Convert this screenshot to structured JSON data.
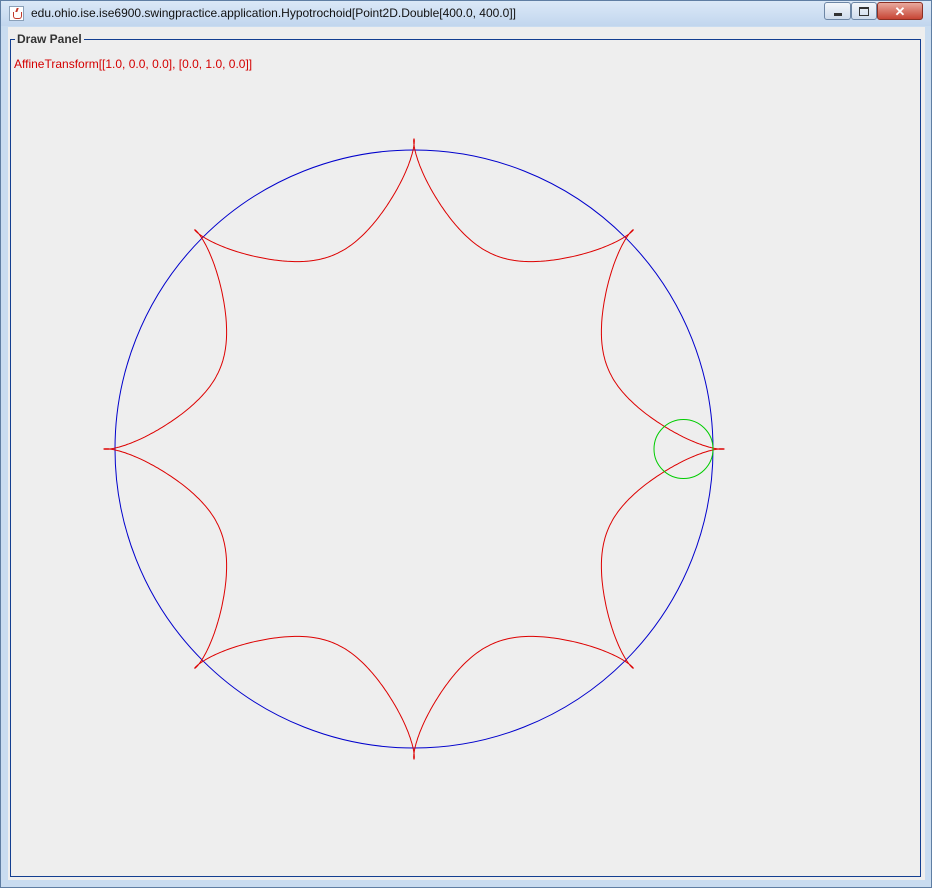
{
  "window": {
    "title": "edu.ohio.ise.ise6900.swingpractice.application.Hypotrochoid[Point2D.Double[400.0, 400.0]]",
    "controls": {
      "minimize": "minimize",
      "maximize": "maximize",
      "close": "✕"
    }
  },
  "panel": {
    "title": "Draw Panel",
    "transform_text": "AffineTransform[[1.0, 0.0, 0.0], [0.0, 1.0, 0.0]]"
  },
  "drawing": {
    "fixed_circle_color": "#0000cc",
    "curve_color": "#dd0000",
    "rolling_circle_color": "#00cc00",
    "curve_lobes": 8
  }
}
